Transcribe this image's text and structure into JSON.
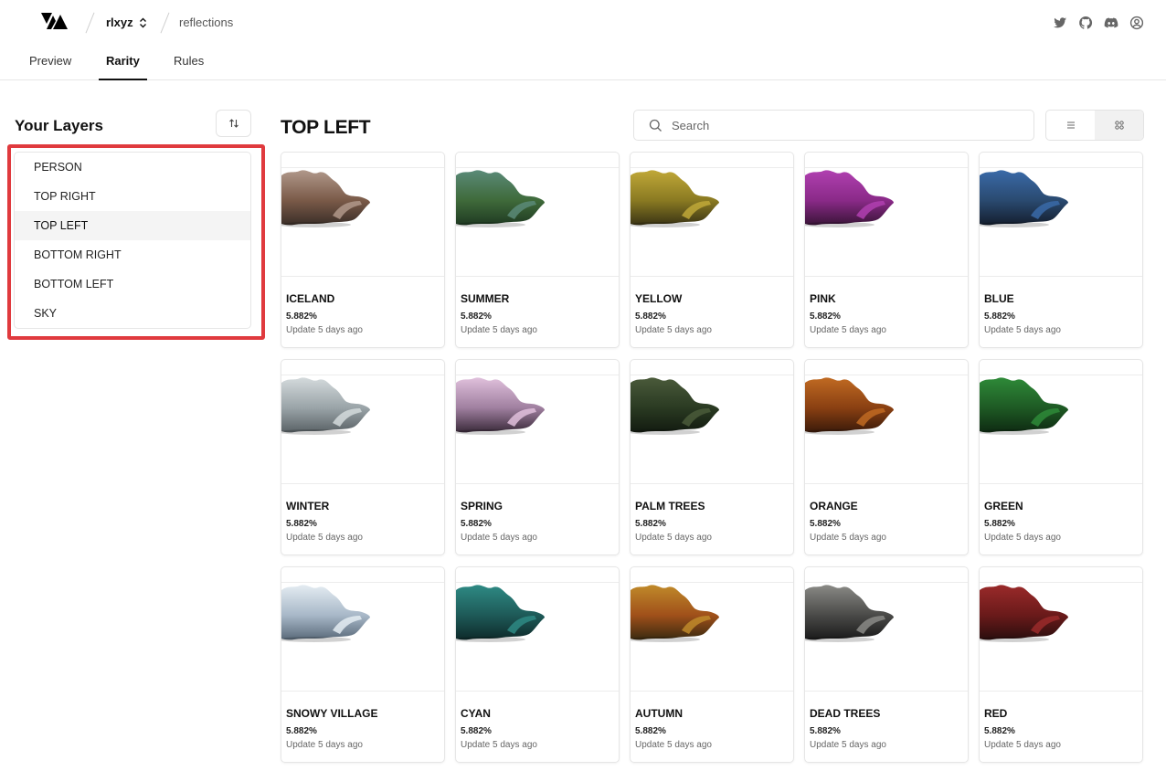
{
  "header": {
    "project": "rlxyz",
    "collection": "reflections",
    "social_icons": [
      "twitter-icon",
      "github-icon",
      "discord-icon",
      "user-icon"
    ]
  },
  "tabs": [
    {
      "label": "Preview",
      "active": false
    },
    {
      "label": "Rarity",
      "active": true
    },
    {
      "label": "Rules",
      "active": false
    }
  ],
  "sidebar": {
    "title": "Your Layers",
    "layers": [
      {
        "label": "PERSON",
        "selected": false
      },
      {
        "label": "TOP RIGHT",
        "selected": false
      },
      {
        "label": "TOP LEFT",
        "selected": true
      },
      {
        "label": "BOTTOM RIGHT",
        "selected": false
      },
      {
        "label": "BOTTOM LEFT",
        "selected": false
      },
      {
        "label": "SKY",
        "selected": false
      }
    ],
    "highlight_color": "#e03a3e"
  },
  "main": {
    "title": "TOP LEFT",
    "search": {
      "placeholder": "Search",
      "value": ""
    },
    "view_mode": "grid",
    "traits": [
      {
        "name": "ICELAND",
        "percent": "5.882%",
        "updated": "Update 5 days ago",
        "colors": [
          "#3a2e28",
          "#7a5a48",
          "#b0988a"
        ]
      },
      {
        "name": "SUMMER",
        "percent": "5.882%",
        "updated": "Update 5 days ago",
        "colors": [
          "#1f3a22",
          "#3f6a3a",
          "#5a8a78"
        ]
      },
      {
        "name": "YELLOW",
        "percent": "5.882%",
        "updated": "Update 5 days ago",
        "colors": [
          "#3a3414",
          "#8a7a22",
          "#c0a838"
        ]
      },
      {
        "name": "PINK",
        "percent": "5.882%",
        "updated": "Update 5 days ago",
        "colors": [
          "#3a1438",
          "#8a2a88",
          "#b040b0"
        ]
      },
      {
        "name": "BLUE",
        "percent": "5.882%",
        "updated": "Update 5 days ago",
        "colors": [
          "#141e2e",
          "#2a4a70",
          "#3a6aa8"
        ]
      },
      {
        "name": "WINTER",
        "percent": "5.882%",
        "updated": "Update 5 days ago",
        "colors": [
          "#5a6266",
          "#9aa4a8",
          "#d4dadc"
        ]
      },
      {
        "name": "SPRING",
        "percent": "5.882%",
        "updated": "Update 5 days ago",
        "colors": [
          "#3a2a3a",
          "#a080a0",
          "#e0c0dc"
        ]
      },
      {
        "name": "PALM TREES",
        "percent": "5.882%",
        "updated": "Update 5 days ago",
        "colors": [
          "#121a10",
          "#2a3a22",
          "#4a5a3a"
        ]
      },
      {
        "name": "ORANGE",
        "percent": "5.882%",
        "updated": "Update 5 days ago",
        "colors": [
          "#3a1a0a",
          "#8a4012",
          "#c06a22"
        ]
      },
      {
        "name": "GREEN",
        "percent": "5.882%",
        "updated": "Update 5 days ago",
        "colors": [
          "#0e2a12",
          "#1e5a24",
          "#2e8a38"
        ]
      },
      {
        "name": "SNOWY VILLAGE",
        "percent": "5.882%",
        "updated": "Update 5 days ago",
        "colors": [
          "#5a6a7a",
          "#a8b8c8",
          "#e4ecf2"
        ]
      },
      {
        "name": "CYAN",
        "percent": "5.882%",
        "updated": "Update 5 days ago",
        "colors": [
          "#0e2a2a",
          "#1e5a58",
          "#2e8a84"
        ]
      },
      {
        "name": "AUTUMN",
        "percent": "5.882%",
        "updated": "Update 5 days ago",
        "colors": [
          "#3a2a10",
          "#a0501a",
          "#c08a2a"
        ]
      },
      {
        "name": "DEAD TREES",
        "percent": "5.882%",
        "updated": "Update 5 days ago",
        "colors": [
          "#1a1a1a",
          "#4a4a48",
          "#8a8a86"
        ]
      },
      {
        "name": "RED",
        "percent": "5.882%",
        "updated": "Update 5 days ago",
        "colors": [
          "#2a0e0e",
          "#6a1a1a",
          "#9a2a2a"
        ]
      }
    ]
  }
}
